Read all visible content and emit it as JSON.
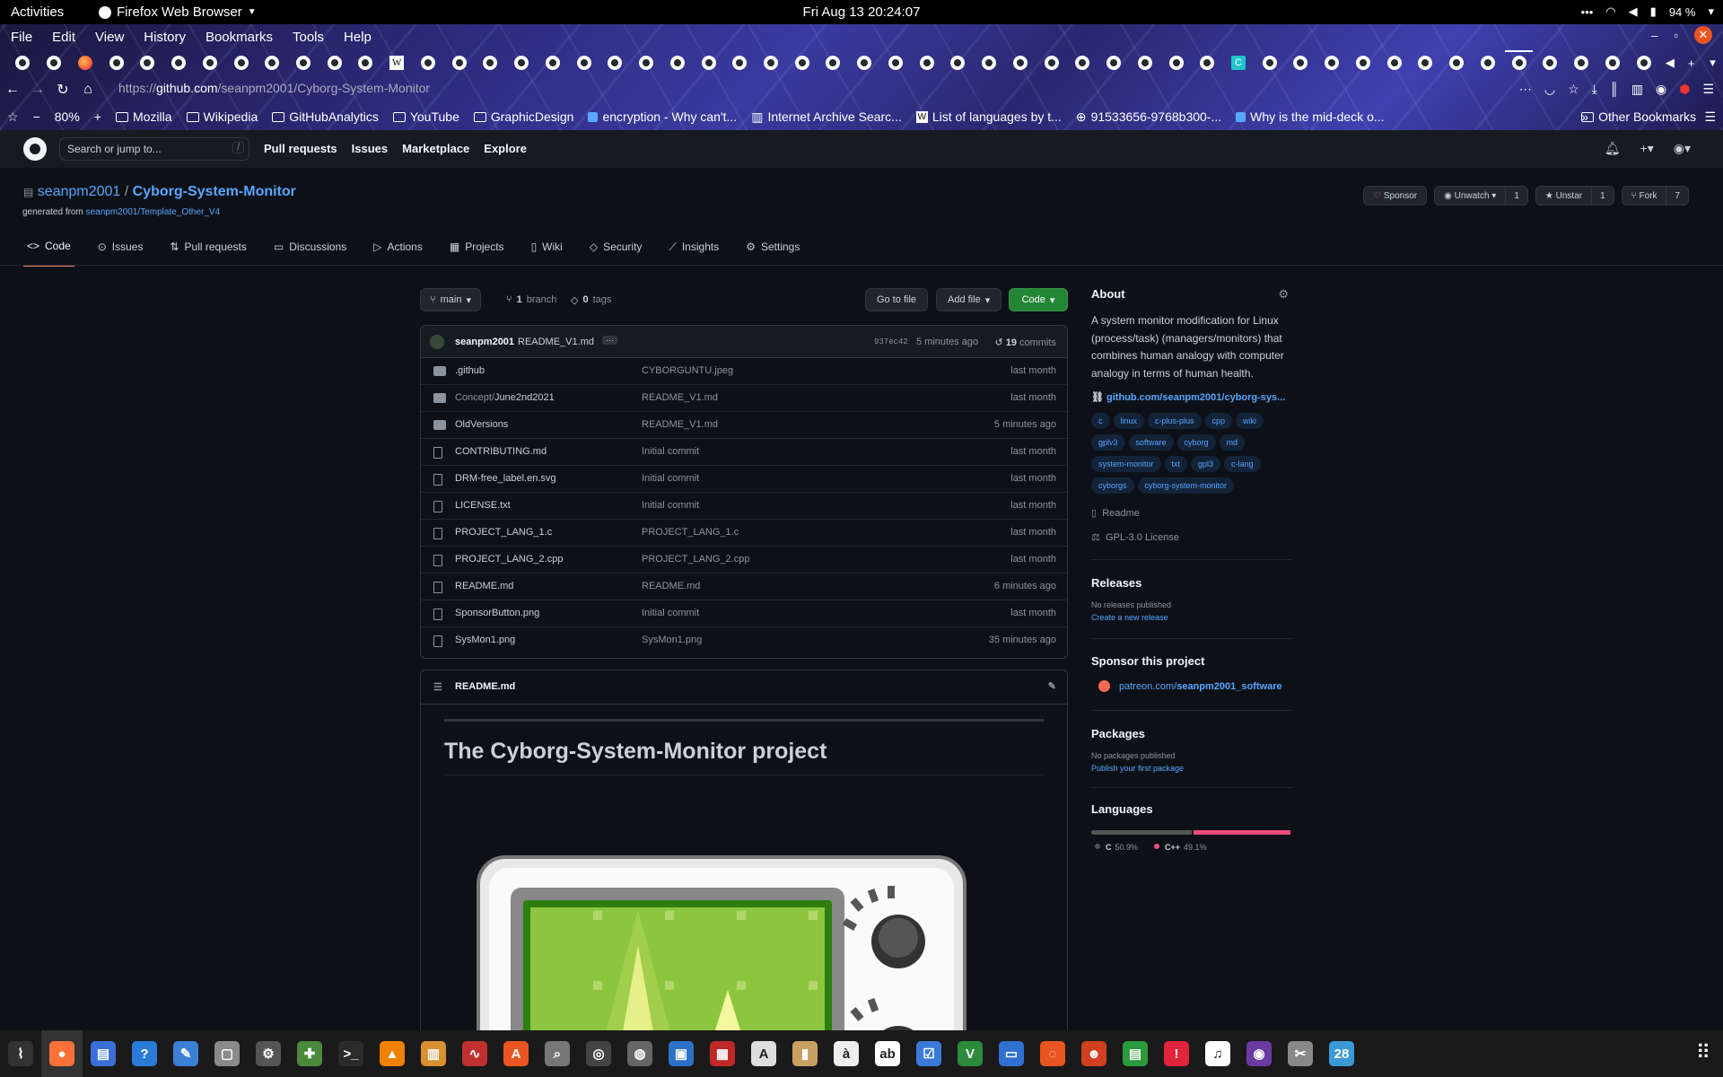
{
  "system_bar": {
    "activities": "Activities",
    "app_name": "Firefox Web Browser",
    "clock": "Fri Aug 13  20:24:07",
    "battery": "94 %"
  },
  "browser": {
    "menu": [
      "File",
      "Edit",
      "View",
      "History",
      "Bookmarks",
      "Tools",
      "Help"
    ],
    "url_prefix": "https://",
    "url_host": "github.com",
    "url_path": "/seanpm2001/Cyborg-System-Monitor",
    "zoom": "80%",
    "bookmarks": [
      {
        "label": "Mozilla",
        "icon": "folder-icon"
      },
      {
        "label": "Wikipedia",
        "icon": "folder-icon"
      },
      {
        "label": "GitHubAnalytics",
        "icon": "folder-icon"
      },
      {
        "label": "YouTube",
        "icon": "folder-icon"
      },
      {
        "label": "GraphicDesign",
        "icon": "folder-icon"
      },
      {
        "label": "encryption - Why can't...",
        "icon": "page-icon"
      },
      {
        "label": "Internet Archive Searc...",
        "icon": "archive-icon"
      },
      {
        "label": "List of languages by t...",
        "icon": "wikipedia-icon"
      },
      {
        "label": "91533656-9768b300-...",
        "icon": "globe-icon"
      },
      {
        "label": "Why is the mid-deck o...",
        "icon": "page-icon"
      }
    ],
    "other_bookmarks": "Other Bookmarks"
  },
  "github": {
    "search_placeholder": "Search or jump to...",
    "search_key": "/",
    "nav": [
      "Pull requests",
      "Issues",
      "Marketplace",
      "Explore"
    ],
    "owner": "seanpm2001",
    "separator": " / ",
    "repo": "Cyborg-System-Monitor",
    "generated_prefix": "generated from ",
    "generated_link": "seanpm2001/Template_Other_V4",
    "actions": {
      "sponsor": "Sponsor",
      "unwatch": "Unwatch",
      "unwatch_count": "1",
      "unstar": "Unstar",
      "star_count": "1",
      "fork": "Fork",
      "fork_count": "7"
    },
    "tabs": [
      "Code",
      "Issues",
      "Pull requests",
      "Discussions",
      "Actions",
      "Projects",
      "Wiki",
      "Security",
      "Insights",
      "Settings"
    ],
    "branch": "main",
    "branches_count": "1",
    "branches_label": "branch",
    "tags_count": "0",
    "tags_label": "tags",
    "go_to_file": "Go to file",
    "add_file": "Add file",
    "code_btn": "Code",
    "commit": {
      "author": "seanpm2001",
      "message": "README_V1.md",
      "sha": "937ec42",
      "time": "5 minutes ago",
      "count": "19",
      "count_label": "commits"
    },
    "files": [
      {
        "name": ".github",
        "type": "dir",
        "message": "CYBORGUNTU.jpeg",
        "time": "last month"
      },
      {
        "name_prefix": "Concept/",
        "name": "June2nd2021",
        "type": "dir",
        "message": "README_V1.md",
        "time": "last month"
      },
      {
        "name": "OldVersions",
        "type": "dir",
        "message": "README_V1.md",
        "time": "5 minutes ago"
      },
      {
        "name": "CONTRIBUTING.md",
        "type": "file",
        "message": "Initial commit",
        "time": "last month"
      },
      {
        "name": "DRM-free_label.en.svg",
        "type": "file",
        "message": "Initial commit",
        "time": "last month"
      },
      {
        "name": "LICENSE.txt",
        "type": "file",
        "message": "Initial commit",
        "time": "last month"
      },
      {
        "name": "PROJECT_LANG_1.c",
        "type": "file",
        "message": "PROJECT_LANG_1.c",
        "time": "last month"
      },
      {
        "name": "PROJECT_LANG_2.cpp",
        "type": "file",
        "message": "PROJECT_LANG_2.cpp",
        "time": "last month"
      },
      {
        "name": "README.md",
        "type": "file",
        "message": "README.md",
        "time": "6 minutes ago"
      },
      {
        "name": "SponsorButton.png",
        "type": "file",
        "message": "Initial commit",
        "time": "last month"
      },
      {
        "name": "SysMon1.png",
        "type": "file",
        "message": "SysMon1.png",
        "time": "35 minutes ago"
      }
    ],
    "readme_file": "README.md",
    "readme_title": "The Cyborg-System-Monitor project",
    "about": {
      "heading": "About",
      "description": "A system monitor modification for Linux (process/task) (managers/monitors) that combines human analogy with computer analogy in terms of human health.",
      "website": "github.com/seanpm2001/cyborg-sys...",
      "topics": [
        "c",
        "linux",
        "c-plus-plus",
        "cpp",
        "wiki",
        "gplv3",
        "software",
        "cyborg",
        "md",
        "system-monitor",
        "txt",
        "gpl3",
        "c-lang",
        "cyborgs",
        "cyborg-system-monitor"
      ],
      "readme": "Readme",
      "license": "GPL-3.0 License"
    },
    "releases": {
      "heading": "Releases",
      "none": "No releases published",
      "create": "Create a new release"
    },
    "sponsor": {
      "heading": "Sponsor this project",
      "link_prefix": "patreon.com/",
      "link_main": "seanpm2001_software"
    },
    "packages": {
      "heading": "Packages",
      "none": "No packages published",
      "publish": "Publish your first package"
    },
    "languages": {
      "heading": "Languages",
      "items": [
        {
          "name": "C",
          "percent": "50.9%",
          "value": 50.9,
          "color": "#555555"
        },
        {
          "name": "C++",
          "percent": "49.1%",
          "value": 49.1,
          "color": "#f34b7d"
        }
      ]
    }
  },
  "dock": {
    "badge_calendar": "28"
  }
}
